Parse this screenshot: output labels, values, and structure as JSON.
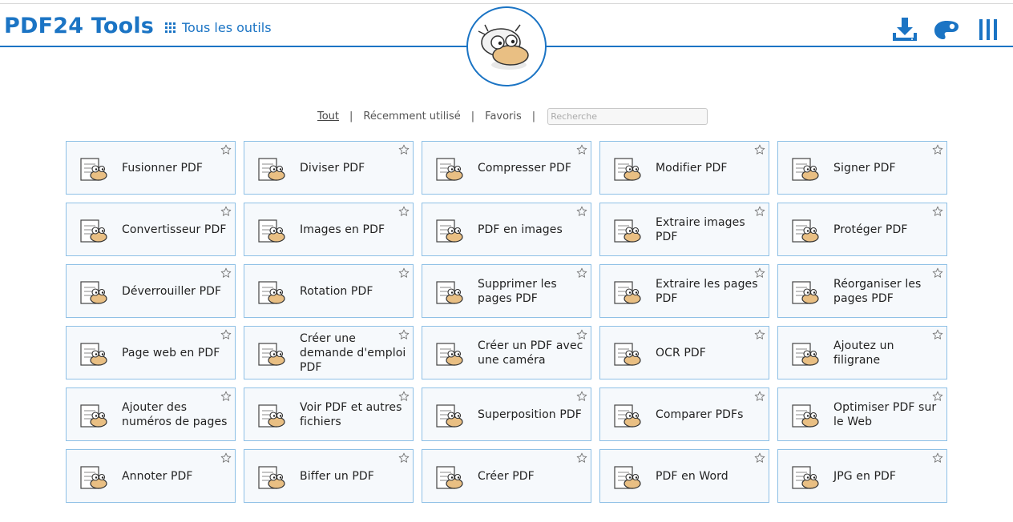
{
  "header": {
    "logo": "PDF24 Tools",
    "all_tools": "Tous les outils",
    "icons": [
      "download-icon",
      "palette-icon",
      "menu-icon"
    ]
  },
  "filters": {
    "all": "Tout",
    "recent": "Récemment utilisé",
    "favorites": "Favoris",
    "search_placeholder": "Recherche"
  },
  "colors": {
    "accent": "#1b74c4",
    "card_border": "#8ec0e6",
    "card_bg": "#f6f9fc"
  },
  "tools": [
    {
      "label": "Fusionner PDF"
    },
    {
      "label": "Diviser PDF"
    },
    {
      "label": "Compresser PDF"
    },
    {
      "label": "Modifier PDF"
    },
    {
      "label": "Signer PDF"
    },
    {
      "label": "Convertisseur PDF"
    },
    {
      "label": "Images en PDF"
    },
    {
      "label": "PDF en images"
    },
    {
      "label": "Extraire images PDF"
    },
    {
      "label": "Protéger PDF"
    },
    {
      "label": "Déverrouiller PDF"
    },
    {
      "label": "Rotation PDF"
    },
    {
      "label": "Supprimer les pages PDF"
    },
    {
      "label": "Extraire les pages PDF"
    },
    {
      "label": "Réorganiser les pages PDF"
    },
    {
      "label": "Page web en PDF"
    },
    {
      "label": "Créer une demande d'emploi PDF"
    },
    {
      "label": "Créer un PDF avec une caméra"
    },
    {
      "label": "OCR PDF"
    },
    {
      "label": "Ajoutez un filigrane"
    },
    {
      "label": "Ajouter des numéros de pages"
    },
    {
      "label": "Voir PDF et autres fichiers"
    },
    {
      "label": "Superposition PDF"
    },
    {
      "label": "Comparer PDFs"
    },
    {
      "label": "Optimiser PDF sur le Web"
    },
    {
      "label": "Annoter PDF"
    },
    {
      "label": "Biffer un PDF"
    },
    {
      "label": "Créer PDF"
    },
    {
      "label": "PDF en Word"
    },
    {
      "label": "JPG en PDF"
    }
  ]
}
